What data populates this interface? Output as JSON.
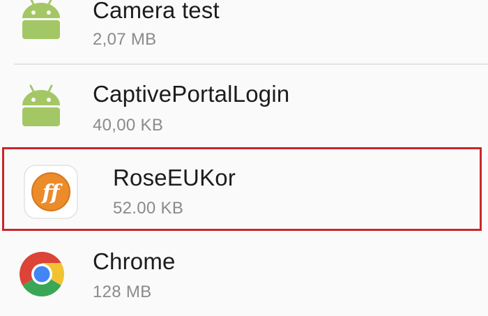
{
  "apps": [
    {
      "name": "Camera test",
      "size": "2,07 MB",
      "icon": "android-icon"
    },
    {
      "name": "CaptivePortalLogin",
      "size": "40,00 KB",
      "icon": "android-icon"
    },
    {
      "name": "RoseEUKor",
      "size": "52.00 KB",
      "icon": "rose-ff-icon",
      "highlighted": true
    },
    {
      "name": "Chrome",
      "size": "128 MB",
      "icon": "chrome-icon"
    }
  ],
  "highlight_color": "#c8262a",
  "android_green": "#a4c766",
  "ff_orange": "#ec8b2a"
}
